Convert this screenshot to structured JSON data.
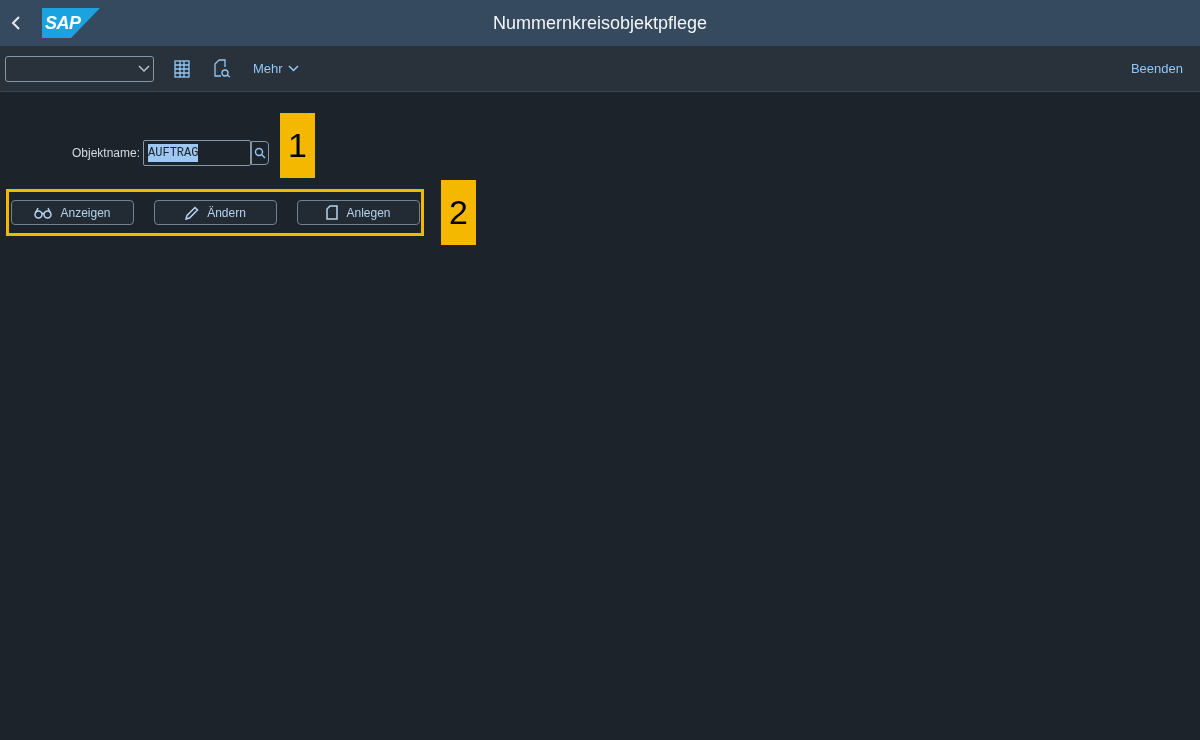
{
  "header": {
    "logo": "SAP",
    "title": "Nummernkreisobjektpflege"
  },
  "toolbar": {
    "more": "Mehr",
    "exit": "Beenden"
  },
  "form": {
    "label": "Objektname:",
    "value": "AUFTRAG",
    "value_selected": true
  },
  "buttons": [
    {
      "kind": "display",
      "label": "Anzeigen"
    },
    {
      "kind": "edit",
      "label": "Ändern"
    },
    {
      "kind": "create",
      "label": "Anlegen"
    }
  ],
  "annotations": [
    "1",
    "2"
  ]
}
